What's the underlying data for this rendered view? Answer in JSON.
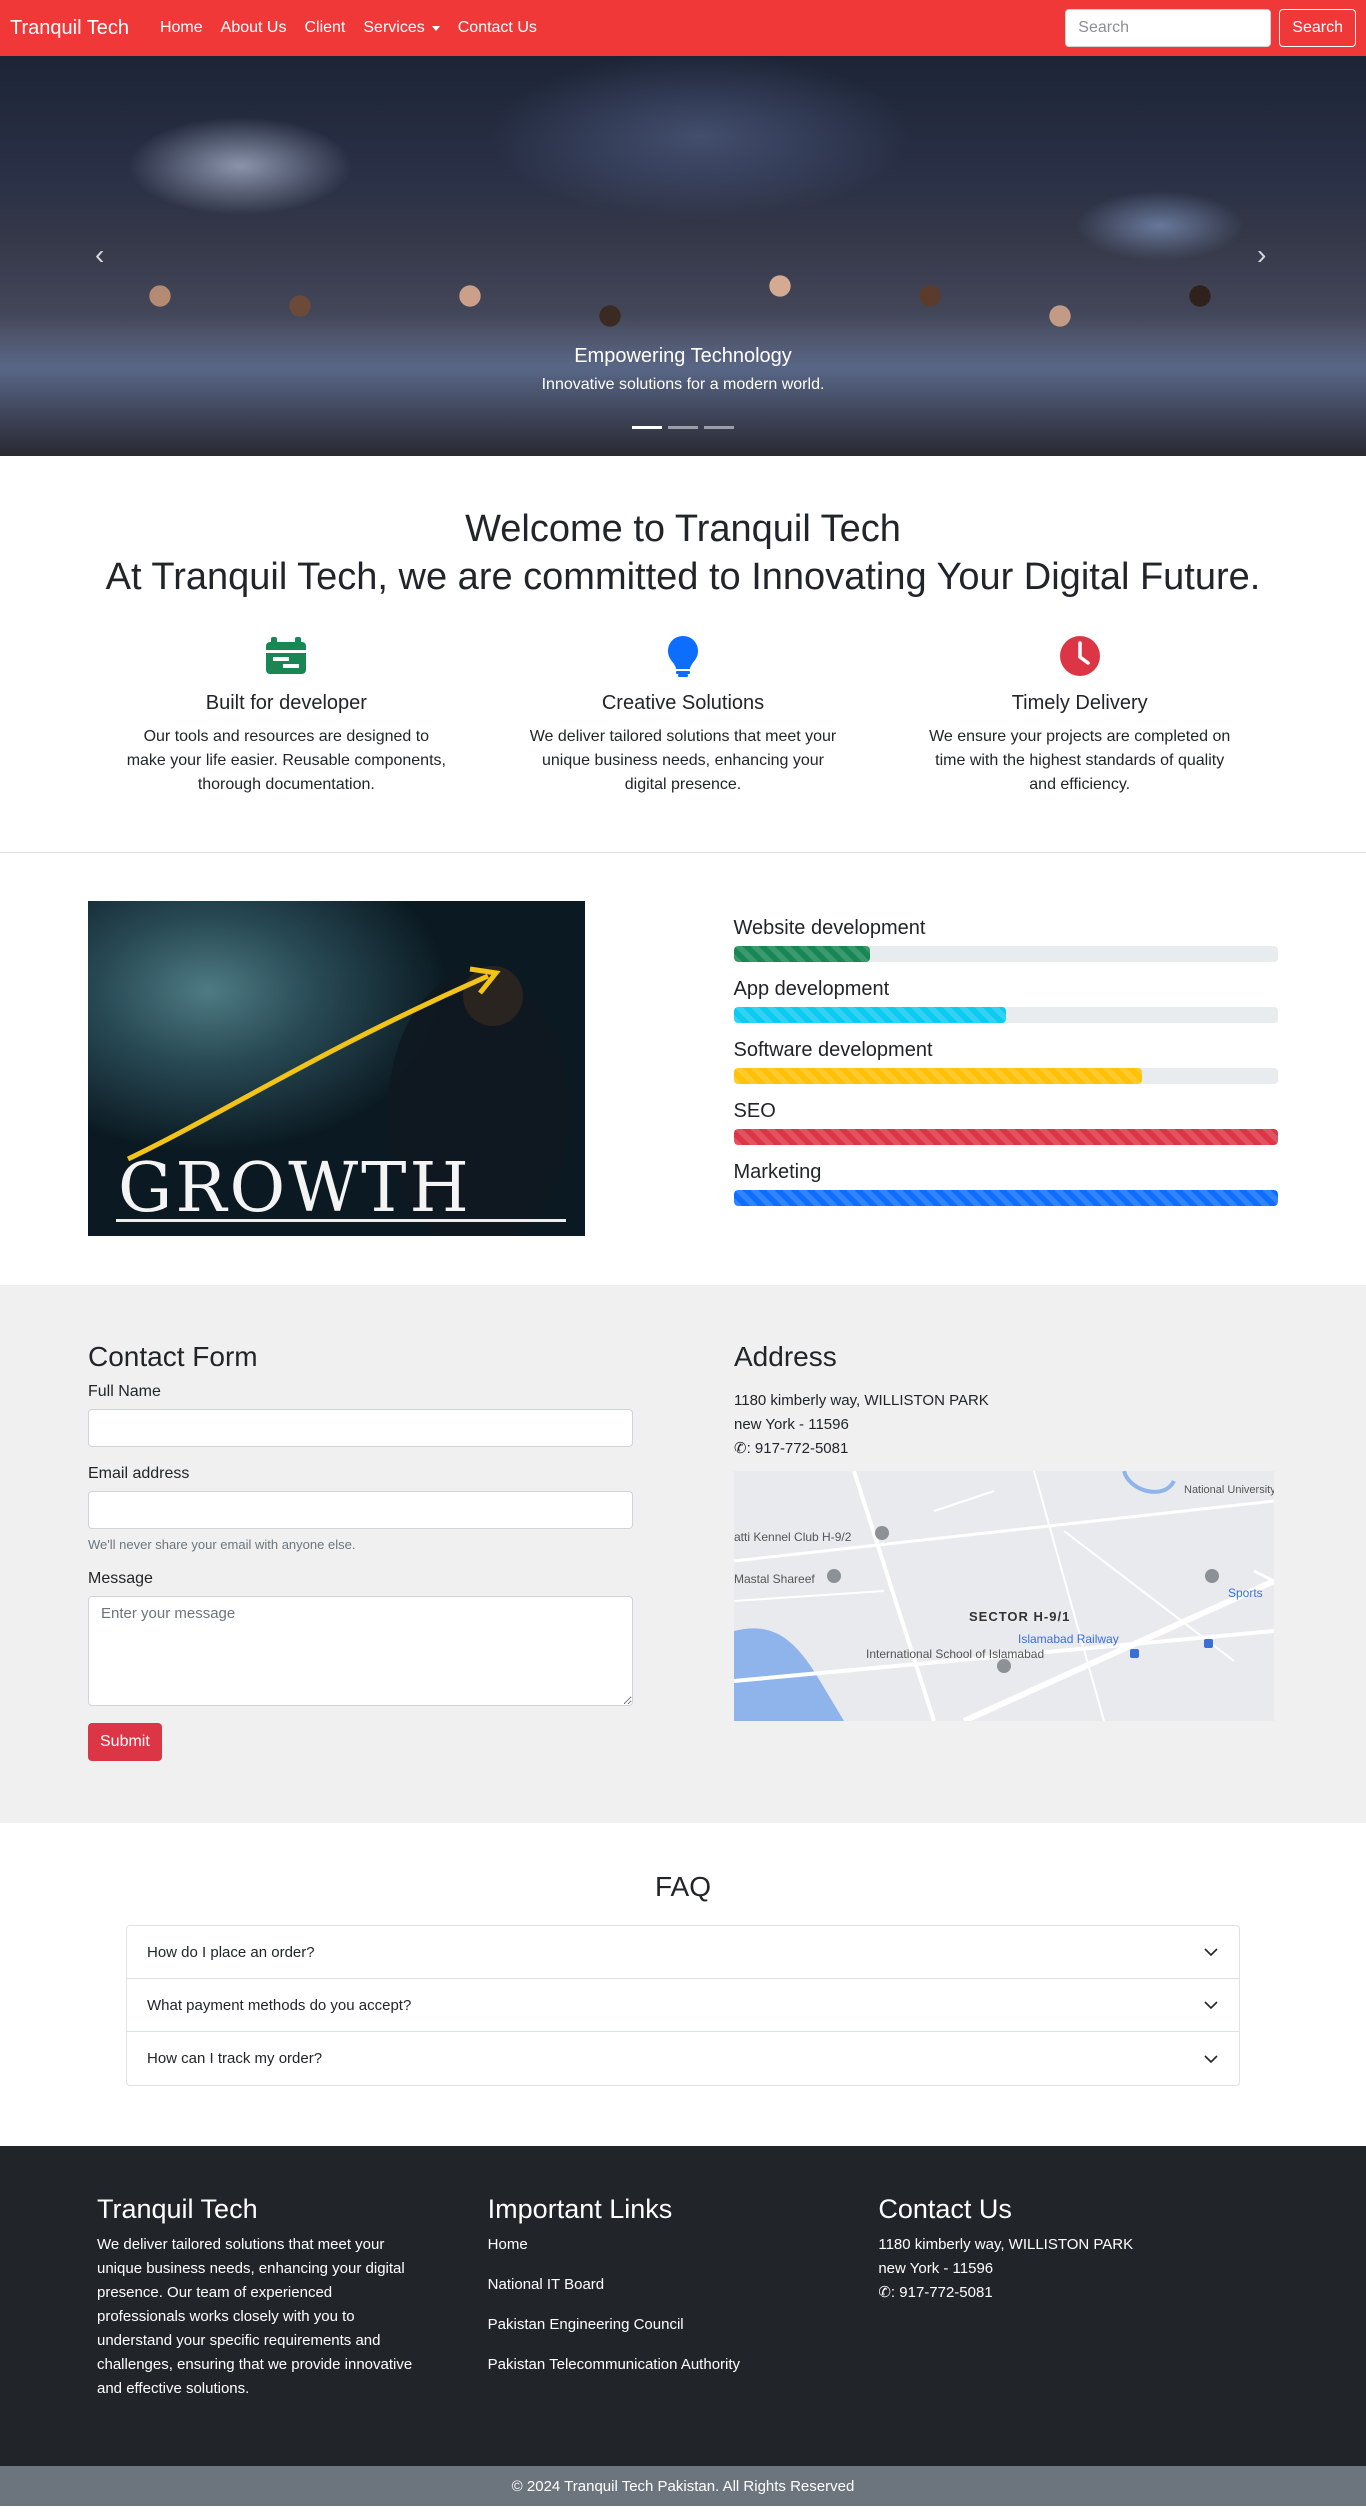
{
  "navbar": {
    "brand": "Tranquil Tech",
    "links": [
      "Home",
      "About Us",
      "Client",
      "Services",
      "Contact Us"
    ],
    "search_placeholder": "Search",
    "search_button": "Search",
    "color": "#f03838"
  },
  "hero": {
    "title": "Empowering Technology",
    "subtitle": "Innovative solutions for a modern world.",
    "slides": 3,
    "active_slide": 1
  },
  "welcome": {
    "line1": "Welcome to Tranquil Tech",
    "line2": "At Tranquil Tech, we are committed to Innovating Your Digital Future."
  },
  "features": [
    {
      "icon": "card-icon",
      "color": "#198754",
      "title": "Built for developer",
      "text": "Our tools and resources are designed to make your life easier. Reusable components, thorough documentation."
    },
    {
      "icon": "lightbulb-icon",
      "color": "#0d6efd",
      "title": "Creative Solutions",
      "text": "We deliver tailored solutions that meet your unique business needs, enhancing your digital presence."
    },
    {
      "icon": "clock-icon",
      "color": "#dc3545",
      "title": "Timely Delivery",
      "text": "We ensure your projects are completed on time with the highest standards of quality and efficiency."
    }
  ],
  "skills": {
    "image_text": "GROWTH",
    "bars": [
      {
        "label": "Website development",
        "percent": 25,
        "color": "#198754"
      },
      {
        "label": "App development",
        "percent": 50,
        "color": "#0dcaf0"
      },
      {
        "label": "Software development",
        "percent": 75,
        "color": "#ffc107"
      },
      {
        "label": "SEO",
        "percent": 100,
        "color": "#dc3545"
      },
      {
        "label": "Marketing",
        "percent": 100,
        "color": "#0d6efd"
      }
    ]
  },
  "contact": {
    "form_title": "Contact Form",
    "name_label": "Full Name",
    "email_label": "Email address",
    "email_help": "We'll never share your email with anyone else.",
    "message_label": "Message",
    "message_placeholder": "Enter your message",
    "submit": "Submit",
    "address_title": "Address",
    "address_line1": "1180 kimberly way, WILLISTON PARK",
    "address_line2": "new York - 11596",
    "phone": ": 917-772-5081",
    "map_labels": {
      "sector": "SECTOR H-9/1",
      "school": "International School of Islamabad",
      "railway": "Islamabad Railway",
      "kennel": "atti Kennel Club H-9/2",
      "mastal": "Mastal Shareef",
      "university": "National University Of Modern Languages",
      "sports": "Sports"
    }
  },
  "faq": {
    "title": "FAQ",
    "questions": [
      "How do I place an order?",
      "What payment methods do you accept?",
      "How can I track my order?"
    ]
  },
  "footer": {
    "about_title": "Tranquil Tech",
    "about_text": "We deliver tailored solutions that meet your unique business needs, enhancing your digital presence. Our team of experienced professionals works closely with you to understand your specific requirements and challenges, ensuring that we provide innovative and effective solutions.",
    "links_title": "Important Links",
    "links": [
      "Home",
      "National IT Board",
      "Pakistan Engineering Council",
      "Pakistan Telecommunication Authority"
    ],
    "contact_title": "Contact Us",
    "address_line1": "1180 kimberly way, WILLISTON PARK",
    "address_line2": "new York - 11596",
    "phone": ": 917-772-5081",
    "copyright": "© 2024 Tranquil Tech Pakistan. All Rights Reserved"
  }
}
